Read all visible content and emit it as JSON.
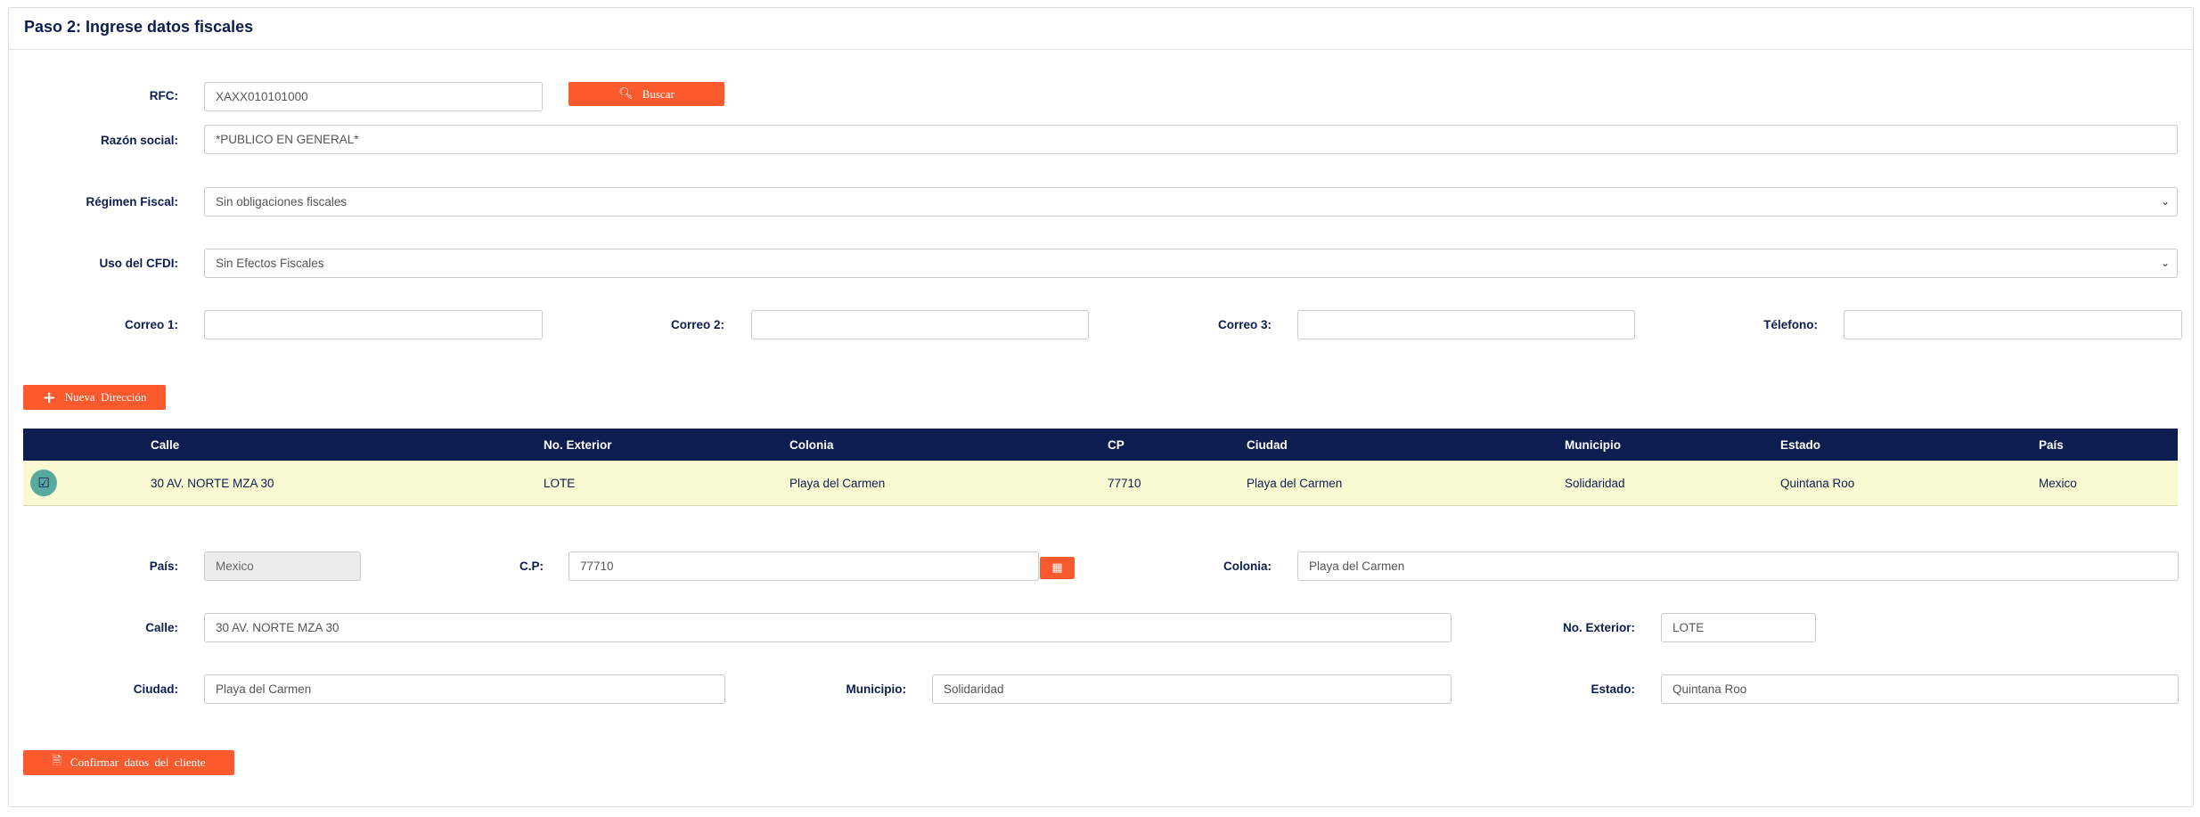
{
  "step": {
    "title": "Paso 2: Ingrese datos fiscales"
  },
  "form": {
    "rfc_label": "RFC:",
    "rfc_value": "XAXX010101000",
    "buscar_label": "Buscar",
    "razon_label": "Razón social:",
    "razon_value": "*PUBLICO EN GENERAL*",
    "regimen_label": "Régimen Fiscal:",
    "regimen_value": "Sin obligaciones fiscales",
    "uso_label": "Uso del CFDI:",
    "uso_value": "Sin Efectos Fiscales",
    "correo1_label": "Correo 1:",
    "correo2_label": "Correo 2:",
    "correo3_label": "Correo 3:",
    "telefono_label": "Télefono:",
    "correo1_value": "",
    "correo2_value": "",
    "correo3_value": "",
    "telefono_value": ""
  },
  "nueva_direccion_label": "Nueva  Dirección",
  "table": {
    "headers": [
      "Calle",
      "No. Exterior",
      "Colonia",
      "CP",
      "Ciudad",
      "Municipio",
      "Estado",
      "País"
    ],
    "rows": [
      [
        "30 AV. NORTE MZA 30",
        "LOTE",
        "Playa del Carmen",
        "77710",
        "Playa del Carmen",
        "Solidaridad",
        "Quintana Roo",
        "Mexico"
      ]
    ]
  },
  "address": {
    "pais_label": "País:",
    "pais_value": "Mexico",
    "cp_label": "C.P:",
    "cp_value": "77710",
    "colonia_label": "Colonia:",
    "colonia_value": "Playa del Carmen",
    "calle_label": "Calle:",
    "calle_value": "30 AV. NORTE MZA 30",
    "noext_label": "No. Exterior:",
    "noext_value": "LOTE",
    "ciudad_label": "Ciudad:",
    "ciudad_value": "Playa del Carmen",
    "municipio_label": "Municipio:",
    "municipio_value": "Solidaridad",
    "estado_label": "Estado:",
    "estado_value": "Quintana Roo"
  },
  "confirmar_label": "Confirmar  datos  del  cliente",
  "icons": {
    "search": "search-icon",
    "plus": "plus-icon",
    "check": "check-icon",
    "calendar": "calendar-icon",
    "document": "document-icon",
    "chevron": "chevron-down-icon"
  },
  "colors": {
    "accent": "#fa5a2e",
    "header": "#0d1d4f",
    "row_selected": "#fafad2",
    "check": "#5aa9a0"
  }
}
